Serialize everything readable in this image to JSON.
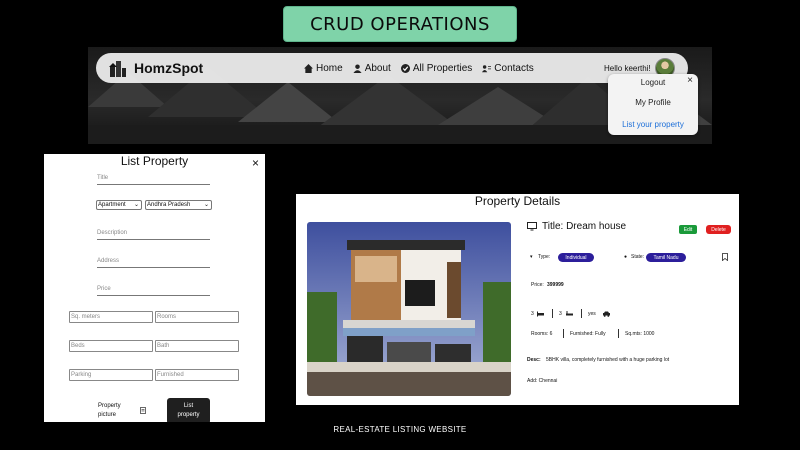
{
  "slide_title": "CRUD OPERATIONS",
  "caption": "REAL-ESTATE LISTING WEBSITE",
  "navbar": {
    "brand": "HomzSpot",
    "links": [
      "Home",
      "About",
      "All Properties",
      "Contacts"
    ],
    "greeting": "Hello keerthi!",
    "profile_menu": {
      "close": "×",
      "items": [
        "Logout",
        "My Profile",
        "List your property"
      ]
    }
  },
  "list_property": {
    "title": "List Property",
    "close": "×",
    "title_placeholder": "Title",
    "type_selected": "Apartment",
    "state_selected": "Andhra Pradesh",
    "description_placeholder": "Description",
    "address_placeholder": "Address",
    "price_placeholder": "Price",
    "sqmeters_placeholder": "Sq. meters",
    "rooms_placeholder": "Rooms",
    "beds_placeholder": "Beds",
    "bath_placeholder": "Bath",
    "parking_placeholder": "Parking",
    "furnished_placeholder": "Furnished",
    "picture_label_1": "Property",
    "picture_label_2": "picture",
    "submit_line_1": "List",
    "submit_line_2": "property"
  },
  "property_details": {
    "heading": "Property Details",
    "title": "Title: Dream house",
    "edit": "Edit",
    "delete": "Delete",
    "type_label": "Type:",
    "type_value": "Individual",
    "state_label": "State:",
    "state_value": "Tamil Nadu",
    "price_label": "Price:",
    "price_value": "399999",
    "beds": "3",
    "baths": "3",
    "parking": "yes",
    "rooms": "Rooms: 6",
    "furnished": "Furnished: Fully",
    "sqmts": "Sq.mts: 1000",
    "desc_label": "Desc:",
    "desc_value": "5BHK villa, completely furnished with a huge parking lot",
    "address": "Add: Chennai"
  },
  "colors": {
    "badge": "#7fd3a9",
    "pill": "#2c1e9b",
    "edit": "#1a9a3a",
    "delete": "#e02020",
    "link": "#1d6fd8"
  }
}
